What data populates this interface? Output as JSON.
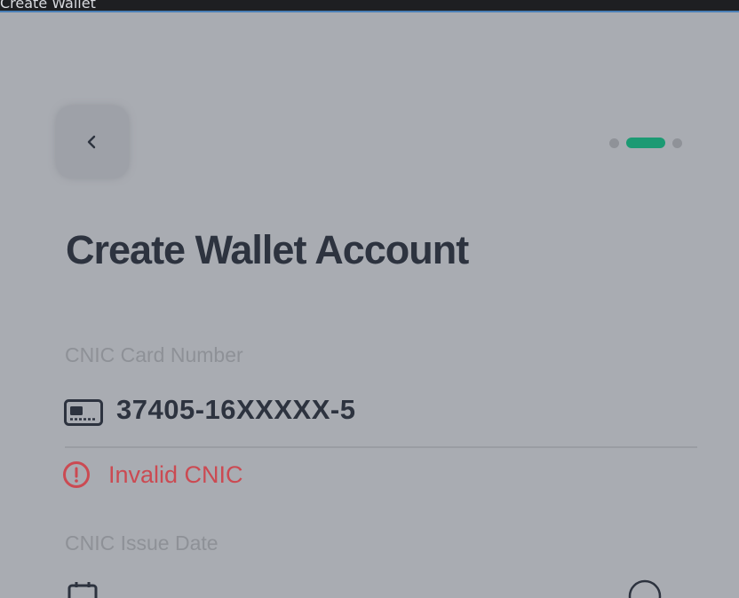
{
  "window": {
    "title": "Create Wallet"
  },
  "header": {
    "back_icon": "chevron-left-icon",
    "stepper": {
      "total_steps": 3,
      "current_step": 2,
      "active_color": "#1c9a73"
    }
  },
  "page": {
    "title": "Create Wallet Account"
  },
  "form": {
    "cnic_number": {
      "label": "CNIC Card Number",
      "icon": "id-card-icon",
      "value": "37405-16XXXXX-5",
      "error": "Invalid CNIC",
      "error_icon": "alert-circle-icon",
      "error_color": "#cb4a52"
    },
    "cnic_issue_date": {
      "label": "CNIC Issue Date",
      "icon": "calendar-icon",
      "trailing_icon": "info-circle-icon"
    }
  },
  "colors": {
    "overlay_background": "#a9acb2",
    "text_primary": "#2d333f",
    "text_secondary": "#8e9197"
  }
}
